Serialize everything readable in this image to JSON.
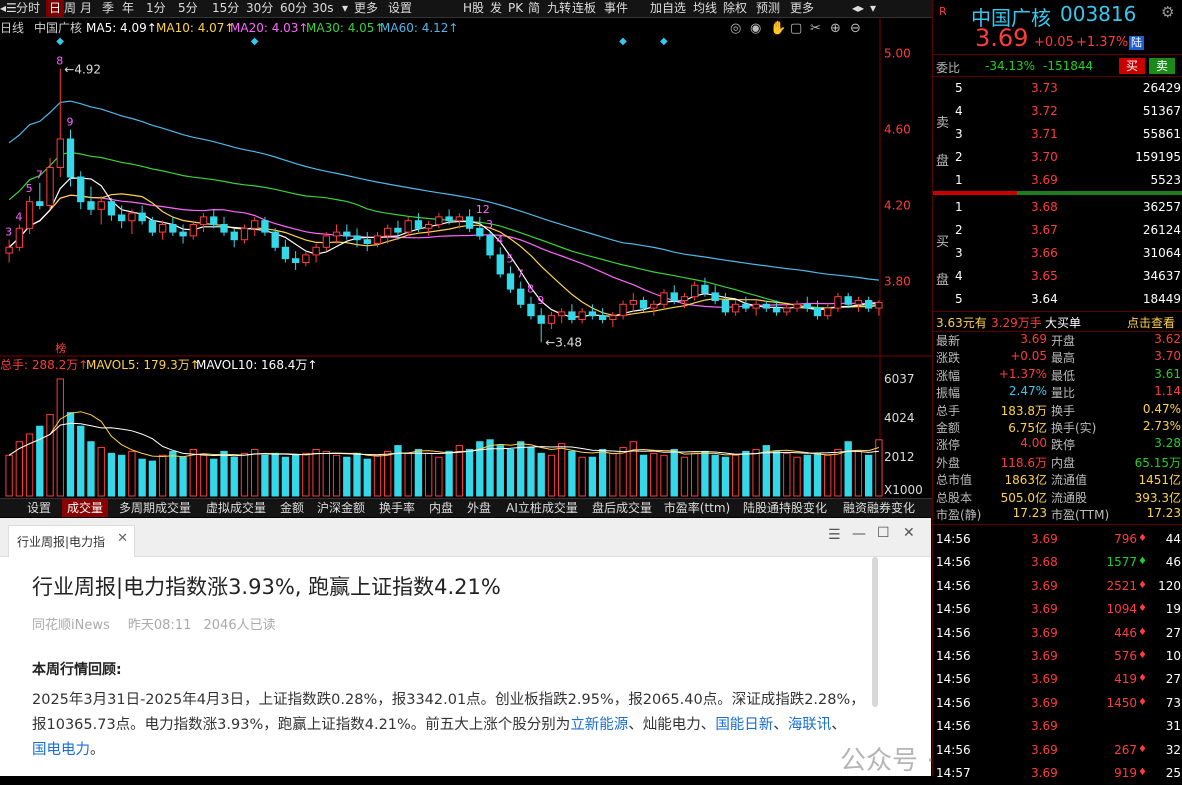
{
  "toolbar": {
    "left_items": [
      "分时",
      "日",
      "周",
      "月",
      "季",
      "年",
      "1分",
      "5分",
      "15分",
      "30分",
      "60分",
      "30s",
      "更多",
      "设置"
    ],
    "active_item": "日",
    "right_items": [
      "H股",
      "发",
      "PK",
      "简",
      "九转",
      "连板",
      "事件",
      "加自选",
      "均线",
      "除权",
      "预测",
      "更多"
    ]
  },
  "chart_header": {
    "period": "日线",
    "name": "中国广核",
    "ma5": "MA5: 4.09",
    "ma10": "MA10: 4.07",
    "ma20": "MA20: 4.03",
    "ma30": "MA30: 4.05",
    "ma60": "MA60: 4.12"
  },
  "colors": {
    "up": "#ff3b3b",
    "down": "#35d8e8",
    "ma5": "#ffffff",
    "ma10": "#ffd24a",
    "ma20": "#ff66ff",
    "ma30": "#3cd13c",
    "ma60": "#4fb8e8",
    "volume_up": "#ff3b3b",
    "volume_down": "#35d8e8"
  },
  "chart_data": [
    {
      "type": "candlestick",
      "ylim": [
        3.45,
        5.05
      ],
      "price_ticks": [
        "5.00",
        "4.60",
        "4.20",
        "3.80"
      ],
      "max_label": "4.92",
      "min_label": "3.48",
      "candles": [
        [
          3.95,
          4.02,
          3.9,
          3.98
        ],
        [
          3.98,
          4.1,
          3.96,
          4.08
        ],
        [
          4.08,
          4.25,
          4.05,
          4.22
        ],
        [
          4.22,
          4.32,
          4.18,
          4.2
        ],
        [
          4.2,
          4.45,
          4.18,
          4.4
        ],
        [
          4.4,
          4.92,
          4.35,
          4.55
        ],
        [
          4.55,
          4.6,
          4.3,
          4.35
        ],
        [
          4.35,
          4.38,
          4.18,
          4.22
        ],
        [
          4.22,
          4.3,
          4.15,
          4.18
        ],
        [
          4.18,
          4.25,
          4.1,
          4.22
        ],
        [
          4.22,
          4.24,
          4.12,
          4.15
        ],
        [
          4.15,
          4.2,
          4.08,
          4.12
        ],
        [
          4.12,
          4.18,
          4.05,
          4.16
        ],
        [
          4.16,
          4.2,
          4.1,
          4.12
        ],
        [
          4.12,
          4.14,
          4.04,
          4.06
        ],
        [
          4.06,
          4.12,
          4.02,
          4.1
        ],
        [
          4.1,
          4.14,
          4.04,
          4.06
        ],
        [
          4.06,
          4.1,
          4.0,
          4.04
        ],
        [
          4.04,
          4.12,
          4.02,
          4.1
        ],
        [
          4.1,
          4.16,
          4.06,
          4.14
        ],
        [
          4.14,
          4.18,
          4.08,
          4.1
        ],
        [
          4.1,
          4.14,
          4.04,
          4.06
        ],
        [
          4.06,
          4.08,
          3.98,
          4.02
        ],
        [
          4.02,
          4.1,
          4.0,
          4.08
        ],
        [
          4.08,
          4.14,
          4.04,
          4.12
        ],
        [
          4.12,
          4.14,
          4.04,
          4.06
        ],
        [
          4.06,
          4.08,
          3.96,
          3.98
        ],
        [
          3.98,
          4.02,
          3.9,
          3.92
        ],
        [
          3.92,
          3.96,
          3.86,
          3.9
        ],
        [
          3.9,
          3.96,
          3.88,
          3.94
        ],
        [
          3.94,
          4.0,
          3.9,
          3.98
        ],
        [
          3.98,
          4.06,
          3.96,
          4.04
        ],
        [
          4.04,
          4.1,
          4.0,
          4.06
        ],
        [
          4.06,
          4.1,
          4.02,
          4.04
        ],
        [
          4.04,
          4.08,
          3.98,
          4.02
        ],
        [
          4.02,
          4.06,
          3.96,
          4.0
        ],
        [
          4.0,
          4.06,
          3.98,
          4.04
        ],
        [
          4.04,
          4.1,
          4.0,
          4.08
        ],
        [
          4.08,
          4.12,
          4.02,
          4.06
        ],
        [
          4.06,
          4.14,
          4.04,
          4.12
        ],
        [
          4.12,
          4.16,
          4.06,
          4.08
        ],
        [
          4.08,
          4.12,
          4.04,
          4.1
        ],
        [
          4.1,
          4.16,
          4.08,
          4.14
        ],
        [
          4.14,
          4.18,
          4.1,
          4.12
        ],
        [
          4.12,
          4.16,
          4.08,
          4.14
        ],
        [
          4.14,
          4.18,
          4.06,
          4.08
        ],
        [
          4.08,
          4.14,
          4.02,
          4.04
        ],
        [
          4.04,
          4.06,
          3.92,
          3.94
        ],
        [
          3.94,
          3.98,
          3.82,
          3.84
        ],
        [
          3.84,
          3.88,
          3.74,
          3.76
        ],
        [
          3.76,
          3.8,
          3.66,
          3.68
        ],
        [
          3.68,
          3.72,
          3.6,
          3.62
        ],
        [
          3.62,
          3.66,
          3.48,
          3.58
        ],
        [
          3.58,
          3.64,
          3.55,
          3.62
        ],
        [
          3.62,
          3.66,
          3.58,
          3.64
        ],
        [
          3.64,
          3.68,
          3.58,
          3.6
        ],
        [
          3.6,
          3.66,
          3.58,
          3.64
        ],
        [
          3.64,
          3.68,
          3.6,
          3.62
        ],
        [
          3.62,
          3.66,
          3.58,
          3.6
        ],
        [
          3.6,
          3.64,
          3.56,
          3.62
        ],
        [
          3.62,
          3.7,
          3.6,
          3.68
        ],
        [
          3.68,
          3.74,
          3.64,
          3.7
        ],
        [
          3.7,
          3.72,
          3.64,
          3.66
        ],
        [
          3.66,
          3.7,
          3.62,
          3.68
        ],
        [
          3.68,
          3.76,
          3.66,
          3.74
        ],
        [
          3.74,
          3.78,
          3.68,
          3.7
        ],
        [
          3.7,
          3.74,
          3.66,
          3.72
        ],
        [
          3.72,
          3.8,
          3.7,
          3.78
        ],
        [
          3.78,
          3.82,
          3.72,
          3.74
        ],
        [
          3.74,
          3.78,
          3.68,
          3.7
        ],
        [
          3.7,
          3.74,
          3.62,
          3.64
        ],
        [
          3.64,
          3.7,
          3.62,
          3.68
        ],
        [
          3.68,
          3.72,
          3.64,
          3.66
        ],
        [
          3.66,
          3.7,
          3.62,
          3.68
        ],
        [
          3.68,
          3.7,
          3.64,
          3.66
        ],
        [
          3.66,
          3.7,
          3.62,
          3.64
        ],
        [
          3.64,
          3.68,
          3.62,
          3.66
        ],
        [
          3.66,
          3.7,
          3.64,
          3.68
        ],
        [
          3.68,
          3.72,
          3.64,
          3.66
        ],
        [
          3.66,
          3.7,
          3.6,
          3.62
        ],
        [
          3.62,
          3.68,
          3.6,
          3.66
        ],
        [
          3.66,
          3.74,
          3.64,
          3.72
        ],
        [
          3.72,
          3.74,
          3.66,
          3.68
        ],
        [
          3.68,
          3.72,
          3.64,
          3.7
        ],
        [
          3.7,
          3.72,
          3.64,
          3.66
        ],
        [
          3.66,
          3.7,
          3.62,
          3.69
        ]
      ],
      "countdown_labels": [
        {
          "i": 0,
          "t": "3"
        },
        {
          "i": 1,
          "t": "4"
        },
        {
          "i": 2,
          "t": "5"
        },
        {
          "i": 3,
          "t": "7"
        },
        {
          "i": 5,
          "t": "8"
        },
        {
          "i": 6,
          "t": "9"
        },
        {
          "i": 46,
          "t": "12"
        },
        {
          "i": 47,
          "t": "3"
        },
        {
          "i": 48,
          "t": "4"
        },
        {
          "i": 49,
          "t": "5"
        },
        {
          "i": 50,
          "t": "7"
        },
        {
          "i": 51,
          "t": "8"
        },
        {
          "i": 52,
          "t": "9"
        }
      ],
      "markers": [
        {
          "i": 5,
          "t": "◆"
        },
        {
          "i": 24,
          "t": "◆"
        },
        {
          "i": 60,
          "t": "◆"
        },
        {
          "i": 64,
          "t": "◆"
        },
        {
          "i": 100,
          "t": "◆"
        }
      ],
      "bottom_markers": [
        {
          "i": 5,
          "t": "榜"
        },
        {
          "i": 100,
          "t": "财"
        }
      ]
    },
    {
      "type": "bar",
      "title": "总手: 288.2万",
      "mavol5": "MAVOL5: 179.3万",
      "mavol10": "MAVOL10: 168.4万",
      "vol_ticks": [
        "6037",
        "4024",
        "2012"
      ],
      "unit": "X1000",
      "ylim": [
        0,
        6500
      ],
      "values": [
        2100,
        2800,
        3200,
        3600,
        4200,
        6037,
        4300,
        3600,
        2800,
        2500,
        2200,
        2100,
        2300,
        1900,
        1800,
        2100,
        2300,
        2000,
        2400,
        2100,
        1900,
        2300,
        2000,
        2200,
        2400,
        2100,
        2200,
        2000,
        2100,
        2200,
        2400,
        2300,
        2100,
        2000,
        2200,
        1900,
        2100,
        2300,
        2600,
        2200,
        2400,
        2200,
        2000,
        2300,
        2600,
        2400,
        2800,
        2900,
        2600,
        2400,
        2800,
        2500,
        2200,
        2100,
        2700,
        2300,
        2000,
        2000,
        2400,
        2200,
        2500,
        2800,
        2100,
        2200,
        2100,
        2400,
        2000,
        2200,
        2300,
        2100,
        2000,
        2100,
        2300,
        2400,
        2600,
        2300,
        2200,
        2000,
        2100,
        2200,
        2100,
        2400,
        2800,
        2300,
        2100,
        2900
      ]
    }
  ],
  "tabs": [
    "设置",
    "成交量",
    "多周期成交量",
    "虚拟成交量",
    "金额",
    "沪深金额",
    "换手率",
    "内盘",
    "外盘",
    "AI立桩成交量",
    "盘后成交量",
    "市盈率(ttm)",
    "陆股通持股变化",
    "融资融券变化"
  ],
  "active_tab": "成交量",
  "quote": {
    "market": "R",
    "name": "中国广核",
    "code": "003816",
    "price": "3.69",
    "change": "+0.05",
    "change_pct": "+1.37%",
    "badge": "陆",
    "weibi_label": "委比",
    "weibi_pct": "-34.13%",
    "weibi_diff": "-151844",
    "buy_btn": "买",
    "sell_btn": "卖",
    "sell_label": "卖盘",
    "buy_label": "买盘",
    "asks": [
      {
        "lvl": "5",
        "price": "3.73",
        "vol": "26429"
      },
      {
        "lvl": "4",
        "price": "3.72",
        "vol": "51367"
      },
      {
        "lvl": "3",
        "price": "3.71",
        "vol": "55861"
      },
      {
        "lvl": "2",
        "price": "3.70",
        "vol": "159195"
      },
      {
        "lvl": "1",
        "price": "3.69",
        "vol": "5523"
      }
    ],
    "bids": [
      {
        "lvl": "1",
        "price": "3.68",
        "vol": "36257"
      },
      {
        "lvl": "2",
        "price": "3.67",
        "vol": "26124"
      },
      {
        "lvl": "3",
        "price": "3.66",
        "vol": "31064"
      },
      {
        "lvl": "4",
        "price": "3.65",
        "vol": "34637"
      },
      {
        "lvl": "5",
        "price": "3.64",
        "vol": "18449"
      }
    ],
    "bigorder_price": "3.63元有",
    "bigorder_amt": "3.29万手",
    "bigorder_label": "大买单",
    "bigorder_link": "点击查看",
    "stats": [
      [
        "最新",
        "3.69",
        "开盘",
        "3.62"
      ],
      [
        "涨跌",
        "+0.05",
        "最高",
        "3.70"
      ],
      [
        "涨幅",
        "+1.37%",
        "最低",
        "3.61"
      ],
      [
        "振幅",
        "2.47%",
        "量比",
        "1.14"
      ],
      [
        "总手",
        "183.8万",
        "换手",
        "0.47%"
      ],
      [
        "金额",
        "6.75亿",
        "换手(实)",
        "2.73%"
      ],
      [
        "涨停",
        "4.00",
        "跌停",
        "3.28"
      ],
      [
        "外盘",
        "118.6万",
        "内盘",
        "65.15万"
      ],
      [
        "总市值",
        "1863亿",
        "流通值",
        "1451亿"
      ],
      [
        "总股本",
        "505.0亿",
        "流通股",
        "393.3亿"
      ],
      [
        "市盈(静)",
        "17.23",
        "市盈(TTM)",
        "17.23"
      ]
    ],
    "ticks": [
      {
        "t": "14:56",
        "p": "3.69",
        "v": "796",
        "n": "44"
      },
      {
        "t": "14:56",
        "p": "3.68",
        "v": "1577",
        "n": "46"
      },
      {
        "t": "14:56",
        "p": "3.69",
        "v": "2521",
        "n": "120"
      },
      {
        "t": "14:56",
        "p": "3.69",
        "v": "1094",
        "n": "19"
      },
      {
        "t": "14:56",
        "p": "3.69",
        "v": "446",
        "n": "27"
      },
      {
        "t": "14:56",
        "p": "3.69",
        "v": "576",
        "n": "10"
      },
      {
        "t": "14:56",
        "p": "3.69",
        "v": "419",
        "n": "27"
      },
      {
        "t": "14:56",
        "p": "3.69",
        "v": "1450",
        "n": "73"
      },
      {
        "t": "14:56",
        "p": "3.69",
        "v": "",
        "n": "31"
      },
      {
        "t": "14:56",
        "p": "3.69",
        "v": "267",
        "n": "32"
      },
      {
        "t": "14:57",
        "p": "3.69",
        "v": "919",
        "n": "25"
      }
    ]
  },
  "news": {
    "tab_title": "行业周报|电力指",
    "headline": "行业周报|电力指数涨3.93%, 跑赢上证指数4.21%",
    "source": "同花顺iNews",
    "time": "昨天08:11",
    "reads": "2046人已读",
    "section": "本周行情回顾:",
    "para_line1": "2025年3月31日-2025年4月3日，上证指数跌0.28%，报3342.01点。创业板指跌2.95%，报2065.40点。深证成指跌2.28%，",
    "para_line2a": "报10365.73点。电力指数涨3.93%，跑赢上证指数4.21%。前五大上涨个股分别为",
    "link1": "立新能源",
    "sep1": "、灿能电力、",
    "link2": "国能日新",
    "sep2": "、",
    "link3": "海联讯",
    "sep3": "、",
    "link4": "国电电力",
    "period_end": "。",
    "watermark": "公众号 · 佳财一分钟"
  }
}
